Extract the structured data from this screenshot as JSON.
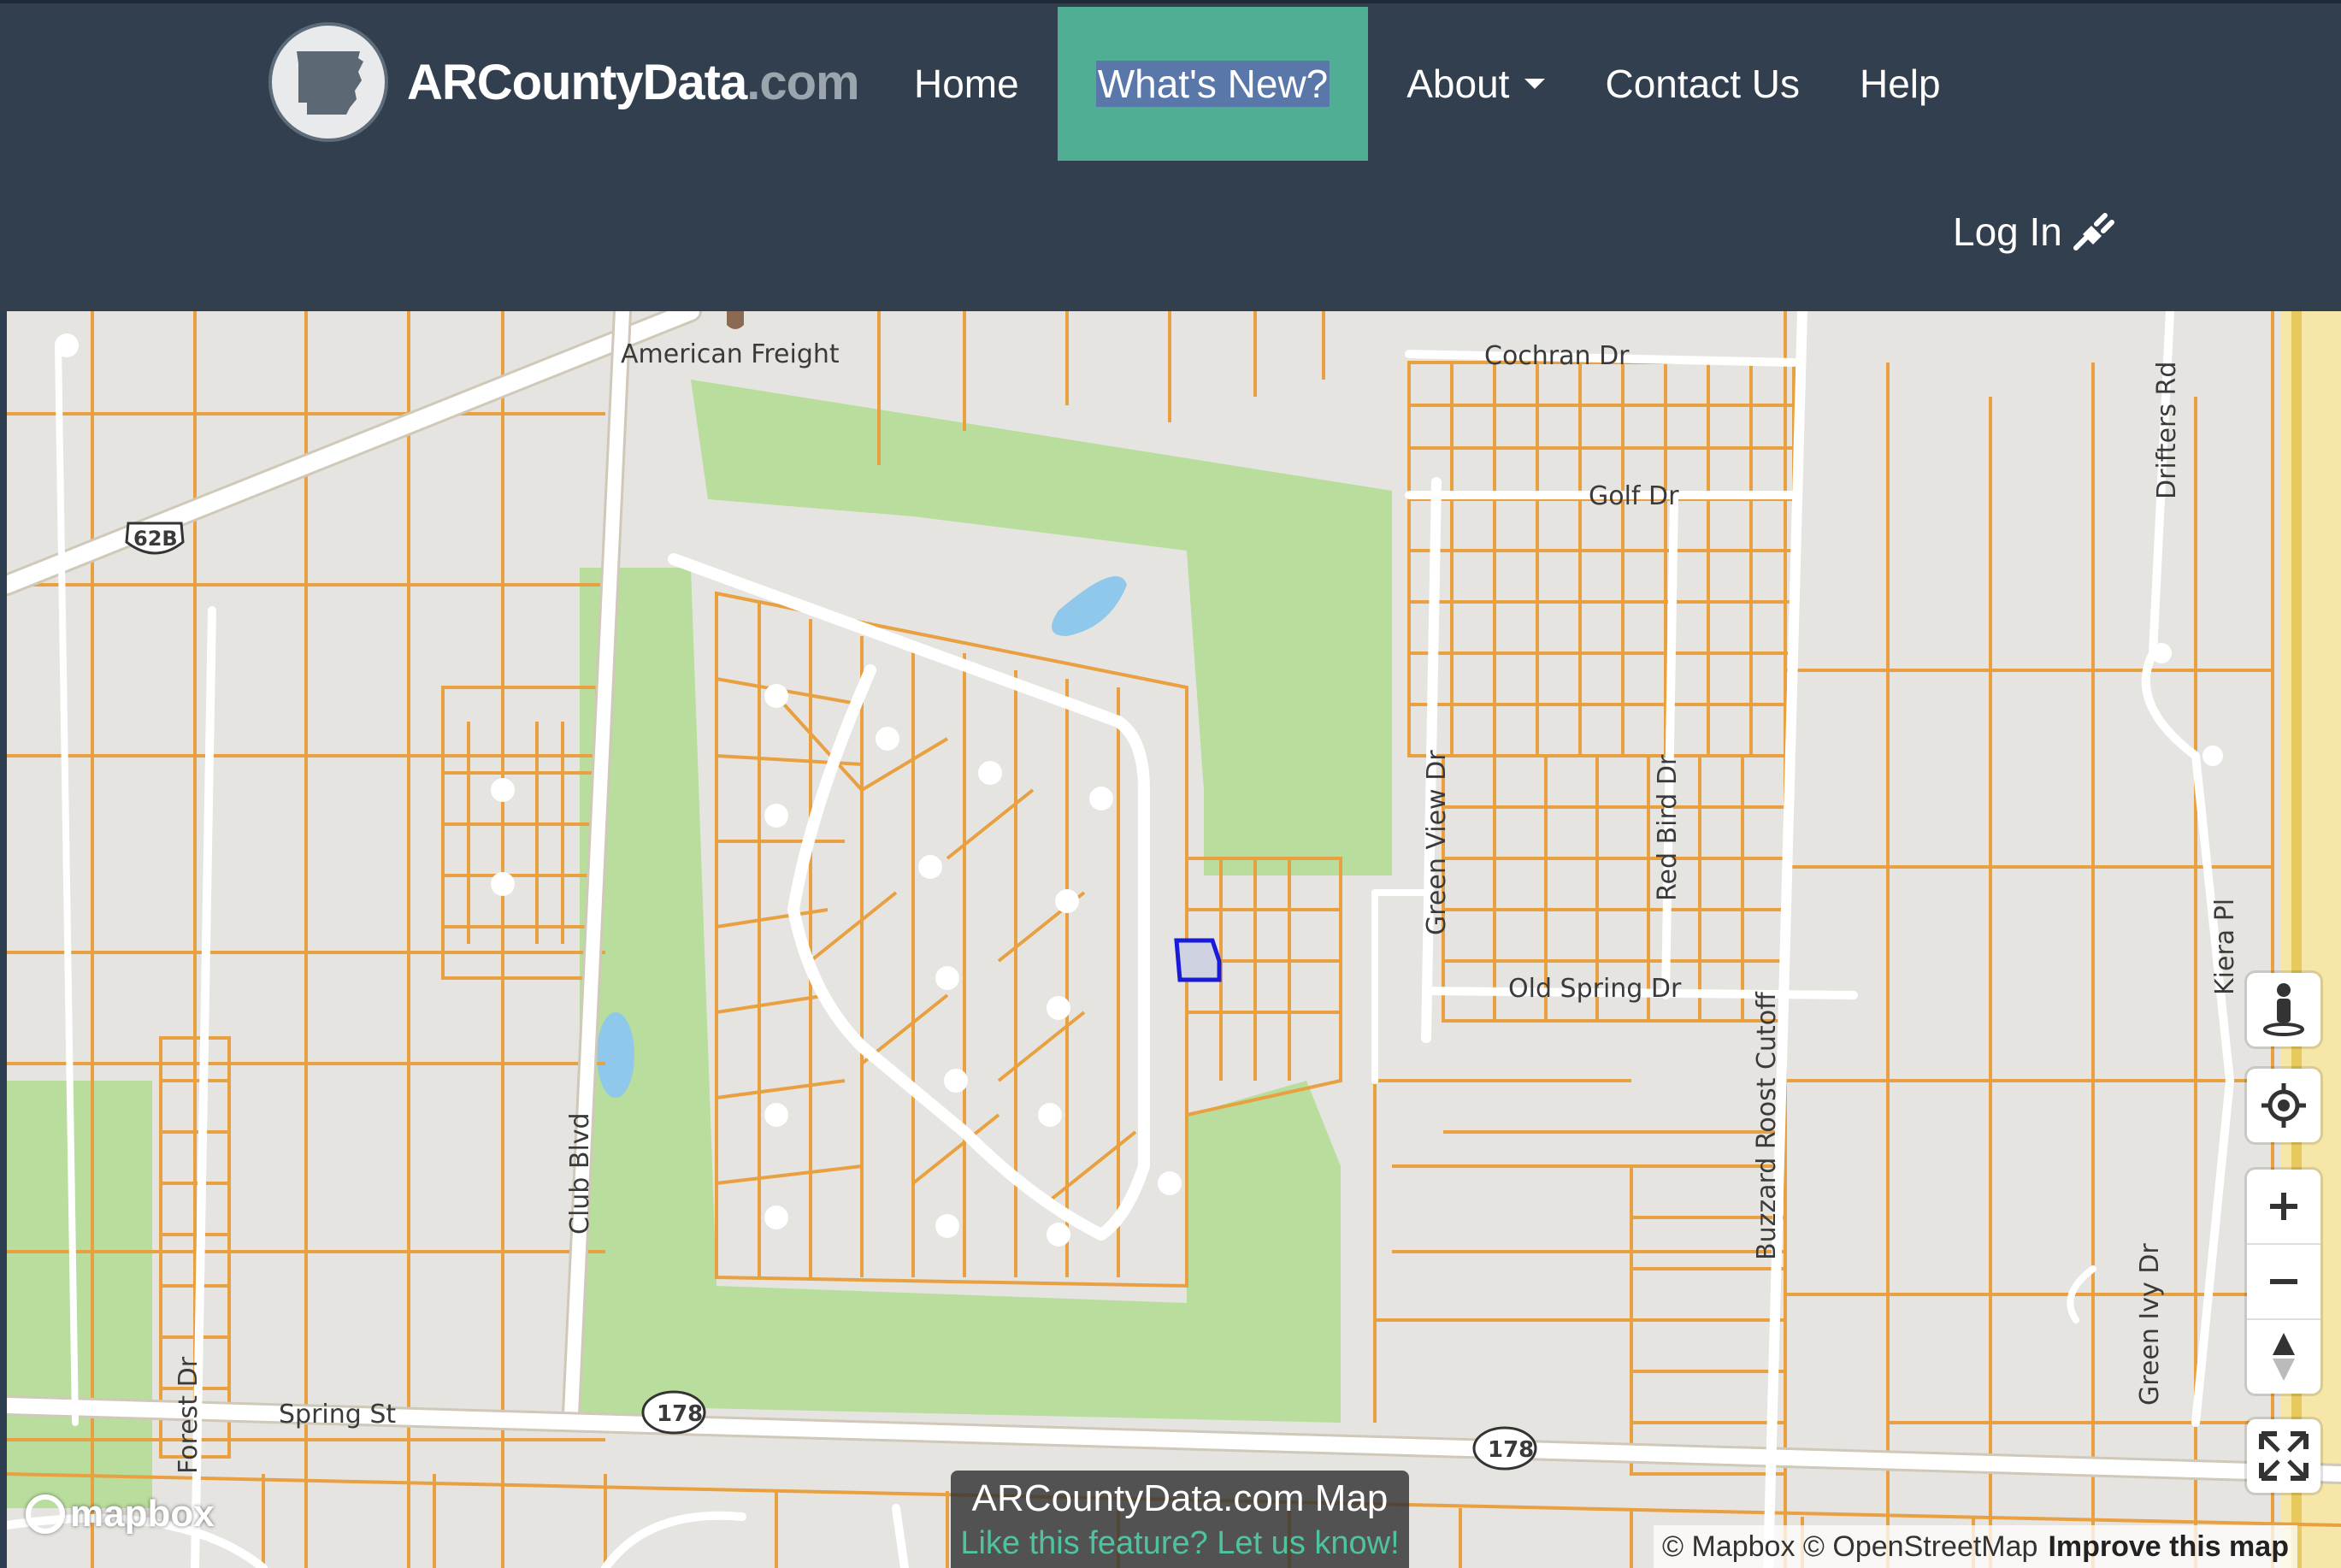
{
  "brand": {
    "name_bold": "ARCountyData",
    "name_suffix": ".com",
    "logo_icon": "arkansas-state-icon"
  },
  "nav": {
    "items": [
      {
        "label": "Home"
      },
      {
        "label": "What's New?",
        "active": true
      },
      {
        "label": "About",
        "dropdown": true
      },
      {
        "label": "Contact Us"
      },
      {
        "label": "Help"
      }
    ],
    "login_label": "Log In",
    "login_icon": "plug-icon"
  },
  "map": {
    "labels": {
      "american_freight": "American Freight",
      "cochran": "Cochran Dr",
      "golf": "Golf Dr",
      "green_view": "Green View Dr",
      "red_bird": "Red Bird Dr",
      "old_spring": "Old Spring Dr",
      "buzzard": "Buzzard Roost Cutoff",
      "club": "Club Blvd",
      "spring": "Spring St",
      "forest": "Forest Dr",
      "drifters": "Drifters Rd",
      "kiera": "Kiera Pl",
      "green_ivy": "Green Ivy Dr",
      "shield_62b": "62B",
      "shield_178a": "178",
      "shield_178b": "178"
    },
    "controls": [
      "street-view-icon",
      "locate-icon",
      "zoom-in-icon",
      "zoom-out-icon",
      "compass-icon",
      "fullscreen-icon"
    ],
    "mapbox_logo": "mapbox",
    "attribution": {
      "mapbox": "© Mapbox",
      "osm": "© OpenStreetMap",
      "improve": "Improve this map"
    },
    "feature": {
      "title": "ARCountyData.com Map",
      "subtitle": "Like this feature? Let us know!"
    },
    "colors": {
      "parcel": "#e8a040",
      "park": "#b8dd9c",
      "water": "#8fc8ea",
      "selection": "#1a1adb"
    }
  }
}
